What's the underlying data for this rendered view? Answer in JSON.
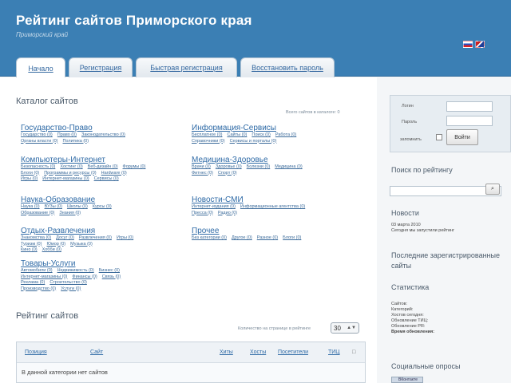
{
  "header": {
    "title": "Рейтинг сайтов Приморского края",
    "subtitle": "Приморский край"
  },
  "tabs": [
    {
      "label": "Начало"
    },
    {
      "label": "Регистрация"
    },
    {
      "label": "Быстрая регистрация"
    },
    {
      "label": "Восстановить пароль"
    }
  ],
  "catalog": {
    "title": "Каталог сайтов",
    "count_text": "Всего сайтов в каталоге: 0",
    "categories": [
      {
        "name": "Государство-Право",
        "subs": [
          "Государство (0)",
          "Право (0)",
          "Законодательство (0)",
          "Органы власти (0)",
          "Политика (0)"
        ]
      },
      {
        "name": "Информация-Сервисы",
        "subs": [
          "Бесплатное (0)",
          "Сайты (0)",
          "Поиск (0)",
          "Работа (0)",
          "Справочники (0)",
          "Сервисы и порталы (0)"
        ]
      },
      {
        "name": "Компьютеры-Интернет",
        "subs": [
          "Безопасность (0)",
          "Хостинг (0)",
          "Веб-дизайн (0)",
          "Форумы (0)",
          "Блоги (0)",
          "Программы и ресурсы (0)",
          "Hardware (0)",
          "Игры (0)",
          "Интернет-магазины (0)",
          "Сервисы (0)"
        ]
      },
      {
        "name": "Медицина-Здоровье",
        "subs": [
          "Врачи (0)",
          "Здоровье (0)",
          "Болезни (0)",
          "Медицина (0)",
          "Фитнес (0)",
          "Спорт (0)"
        ]
      },
      {
        "name": "Наука-Образование",
        "subs": [
          "Наука (0)",
          "ВУЗы (0)",
          "Школы (0)",
          "Курсы (0)",
          "Образование (0)",
          "Знания (0)"
        ]
      },
      {
        "name": "Новости-СМИ",
        "subs": [
          "Интернет-издания (0)",
          "Информационные агентства (0)",
          "Пресса (0)",
          "Радио (0)"
        ]
      },
      {
        "name": "Отдых-Развлечения",
        "subs": [
          "Знакомства (0)",
          "Досуг (0)",
          "Развлечения (0)",
          "Игры (0)",
          "Туризм (0)",
          "Юмор (0)",
          "Музыка (0)",
          "Кино (0)",
          "Хобби (0)"
        ]
      },
      {
        "name": "Прочее",
        "subs": [
          "Без категории (0)",
          "Другое (0)",
          "Разное (0)",
          "Блоги (0)"
        ]
      },
      {
        "name": "Товары-Услуги",
        "subs": [
          "Автомобили (0)",
          "Недвижимость (0)",
          "Бизнес (0)",
          "Интернет-магазины (0)",
          "Финансы (0)",
          "Связь (0)",
          "Реклама (0)",
          "Строительство (0)",
          "Производство (0)",
          "Услуги (0)"
        ]
      }
    ]
  },
  "rating": {
    "title": "Рейтинг сайтов",
    "per_page_label": "Количество на странице в рейтинге",
    "per_page_value": "30",
    "columns": [
      "Позиция",
      "Сайт",
      "Хиты",
      "Хосты",
      "Посетители",
      "ТИЦ",
      "□"
    ],
    "empty_text": "В данной категории нет сайтов"
  },
  "sidebar": {
    "login_label": "Логин",
    "password_label": "Пароль",
    "remember_label": "запомнить",
    "login_button": "Войти",
    "search_title": "Поиск по рейтингу",
    "news_title": "Новости",
    "news_lines": [
      "03 марта 2010",
      "Сегодня мы запустили рейтинг"
    ],
    "latest_title": "Последние зарегистрированные сайты",
    "stats_title": "Статистика",
    "stats_lines": [
      "Сайтов:",
      "Категорий:",
      "Хостов сегодня:",
      "Обновление ТИЦ:",
      "Обновление PR:",
      "Время обновления:"
    ],
    "social_title": "Социальные опросы",
    "social_button": "ВКонтакте"
  }
}
